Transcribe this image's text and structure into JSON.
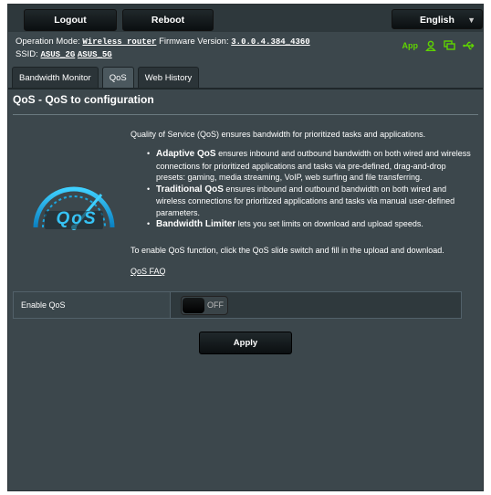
{
  "topbar": {
    "logout_label": "Logout",
    "reboot_label": "Reboot",
    "language": "English"
  },
  "info": {
    "operation_mode_label": "Operation Mode:",
    "operation_mode_value": "Wireless router",
    "firmware_label": "Firmware Version:",
    "firmware_value": "3.0.0.4.384_4360",
    "ssid_label": "SSID:",
    "ssid_2g": "ASUS_2G",
    "ssid_5g": "ASUS_5G"
  },
  "status_icons": {
    "app_label": "App",
    "icons": [
      "user-icon",
      "monitor-icon",
      "usb-icon"
    ],
    "color": "#5fd400"
  },
  "tabs": [
    {
      "label": "Bandwidth Monitor",
      "active": false
    },
    {
      "label": "QoS",
      "active": true
    },
    {
      "label": "Web History",
      "active": false
    }
  ],
  "main": {
    "heading": "QoS - QoS to configuration",
    "intro": "Quality of Service (QoS) ensures bandwidth for prioritized tasks and applications.",
    "bullets": [
      {
        "title": "Adaptive QoS",
        "text": " ensures inbound and outbound bandwidth on both wired and wireless connections for prioritized applications and tasks via pre-defined, drag-and-drop presets: gaming, media streaming, VoIP, web surfing and file transferring."
      },
      {
        "title": "Traditional QoS",
        "text": " ensures inbound and outbound bandwidth on both wired and wireless connections for prioritized applications and tasks via manual user-defined parameters."
      },
      {
        "title": "Bandwidth Limiter",
        "text": " lets you set limits on download and upload speeds."
      }
    ],
    "note": "To enable QoS function, click the QoS slide switch and fill in the upload and download.",
    "faq_link": "QoS FAQ",
    "logo_text": "QoS"
  },
  "settings": {
    "enable_qos_label": "Enable QoS",
    "toggle_state": "OFF"
  },
  "apply_label": "Apply"
}
